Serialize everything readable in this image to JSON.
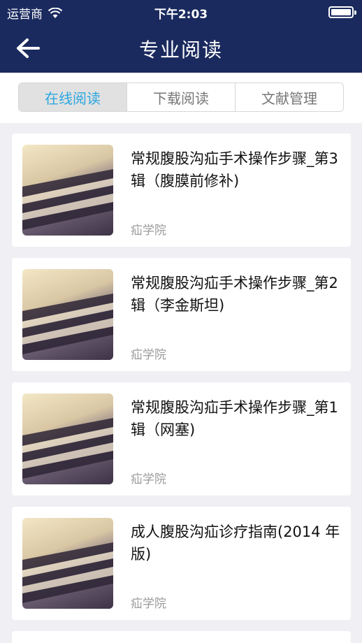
{
  "status_bar": {
    "carrier": "运营商",
    "time": "下午2:03"
  },
  "nav": {
    "title": "专业阅读"
  },
  "tabs": [
    {
      "label": "在线阅读",
      "active": true
    },
    {
      "label": "下载阅读",
      "active": false
    },
    {
      "label": "文献管理",
      "active": false
    }
  ],
  "items": [
    {
      "title": "常规腹股沟疝手术操作步骤_第3辑（腹膜前修补)",
      "source": "疝学院"
    },
    {
      "title": "常规腹股沟疝手术操作步骤_第2辑（李金斯坦)",
      "source": "疝学院"
    },
    {
      "title": "常规腹股沟疝手术操作步骤_第1辑（网塞)",
      "source": "疝学院"
    },
    {
      "title": "成人腹股沟疝诊疗指南(2014 年版)",
      "source": "疝学院"
    }
  ],
  "colors": {
    "nav_bg": "#1a2a5e",
    "tab_active_text": "#2ca6e0",
    "source_text": "#9a9a9a"
  }
}
